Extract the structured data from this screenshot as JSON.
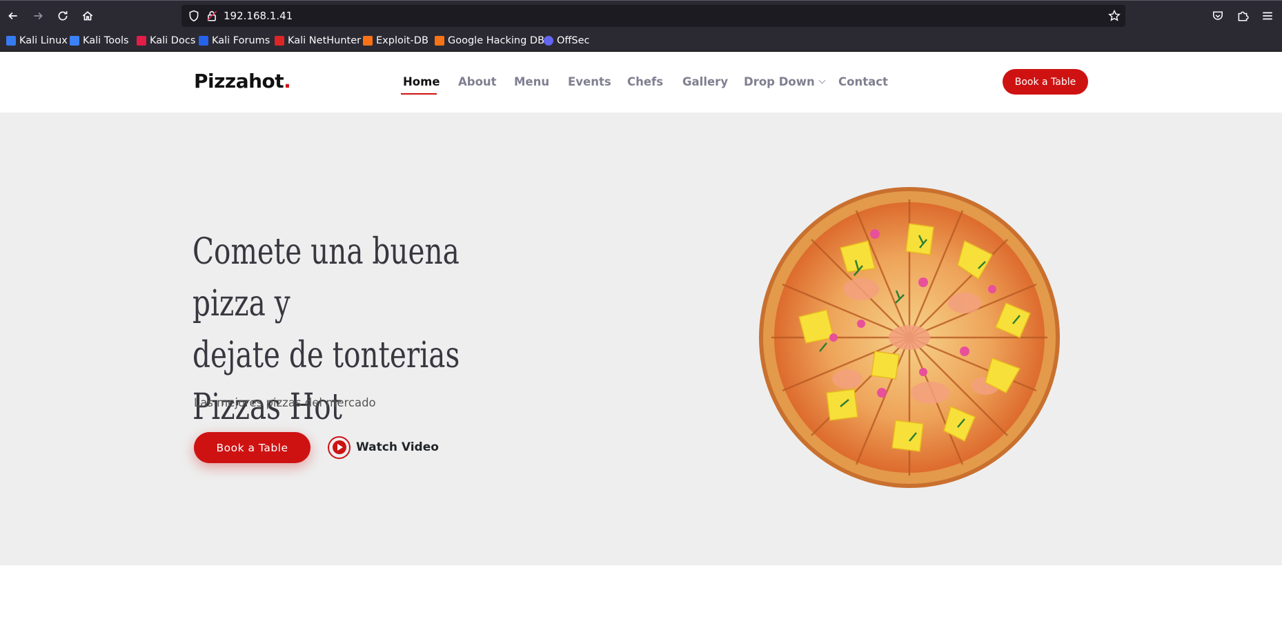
{
  "browser": {
    "url": "192.168.1.41",
    "icons": [
      "back-icon",
      "forward-icon",
      "reload-icon",
      "home-icon",
      "shield-icon",
      "lock-icon",
      "star-icon",
      "pocket-icon",
      "extensions-icon",
      "menu-icon"
    ],
    "bookmarks": [
      {
        "label": "Kali Linux",
        "color": "#367bf0"
      },
      {
        "label": "Kali Tools",
        "color": "#3b82f6"
      },
      {
        "label": "Kali Docs",
        "color": "#e11d48"
      },
      {
        "label": "Kali Forums",
        "color": "#2563eb"
      },
      {
        "label": "Kali NetHunter",
        "color": "#dc2626"
      },
      {
        "label": "Exploit-DB",
        "color": "#f97316"
      },
      {
        "label": "Google Hacking DB",
        "color": "#f97316"
      },
      {
        "label": "OffSec",
        "color": "#6366f1"
      }
    ]
  },
  "site": {
    "logo": "Pizzahot",
    "logo_dot": ".",
    "nav": [
      "Home",
      "About",
      "Menu",
      "Events",
      "Chefs",
      "Gallery",
      "Drop Down",
      "Contact"
    ],
    "header_button": "Book a Table",
    "accent_color": "#ce1212"
  },
  "hero": {
    "title_lines": [
      "Comete una buena pizza y",
      "dejate de tonterias",
      "Pizzas Hot"
    ],
    "subtitle": "Las mejores pizzas del mercado",
    "primary_button": "Book a Table",
    "video_link": "Watch Video",
    "image": "pizza-image"
  }
}
